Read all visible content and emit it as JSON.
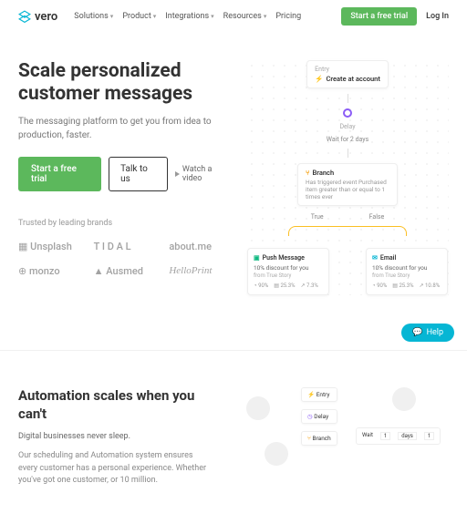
{
  "nav": {
    "brand": "vero",
    "links": [
      "Solutions",
      "Product",
      "Integrations",
      "Resources",
      "Pricing"
    ],
    "cta": "Start a free trial",
    "login": "Log In"
  },
  "hero": {
    "title": "Scale personalized customer messages",
    "subtitle": "The messaging platform to get you from idea to production, faster.",
    "primary_cta": "Start a free trial",
    "secondary_cta": "Talk to us",
    "video_cta": "Watch a video",
    "trusted": "Trusted by leading brands",
    "brands": [
      "Unsplash",
      "T I D A L",
      "about.me",
      "monzo",
      "Ausmed",
      "HelloPrint"
    ]
  },
  "flow": {
    "entry_label": "Entry",
    "entry_title": "Create at account",
    "delay_label": "Delay",
    "delay_desc": "Wait for 2 days",
    "branch_label": "Branch",
    "branch_desc": "Has triggered event Purchased item greater than or equal to 1 times ever",
    "true_label": "True",
    "false_label": "False",
    "push": {
      "title": "Push Message",
      "subject": "10% discount for you",
      "from": "from True Story",
      "stat1": "90%",
      "stat2": "25.3%",
      "stat3": "7.3%"
    },
    "email": {
      "title": "Email",
      "subject": "10% discount for you",
      "from": "from True Story",
      "stat1": "90%",
      "stat2": "25.3%",
      "stat3": "10.8%"
    }
  },
  "help": "Help",
  "section2": {
    "title": "Automation scales when you can't",
    "subtitle": "Digital businesses never sleep.",
    "body": "Our scheduling and Automation system ensures every customer has a personal experience. Whether you've got one customer, or 10 million.",
    "mini": {
      "entry": "Entry",
      "delay": "Delay",
      "branch": "Branch",
      "wait": "Wait"
    }
  }
}
